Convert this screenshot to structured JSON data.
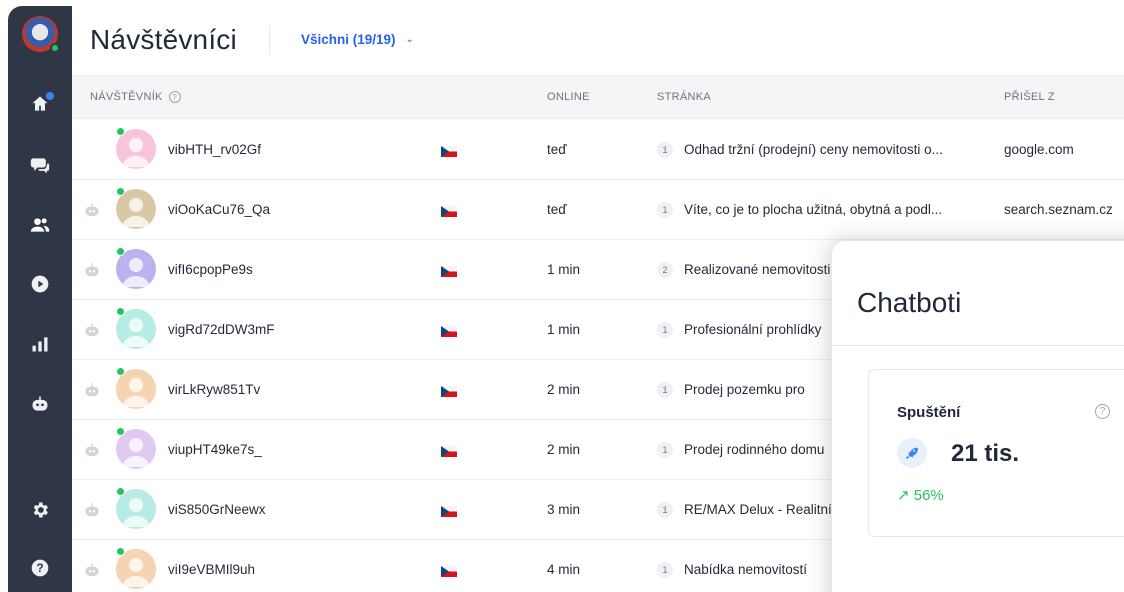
{
  "header": {
    "title": "Návštěvníci",
    "filter_label": "Všichni (19/19)"
  },
  "sidebar": {
    "items": [
      {
        "name": "home-icon"
      },
      {
        "name": "chat-icon"
      },
      {
        "name": "visitors-icon"
      },
      {
        "name": "play-icon"
      },
      {
        "name": "stats-icon"
      },
      {
        "name": "bot-icon"
      },
      {
        "name": "gear-icon"
      },
      {
        "name": "help-icon"
      }
    ]
  },
  "table": {
    "columns": {
      "visitor": "NÁVŠTĚVNÍK",
      "online": "ONLINE",
      "page": "STRÁNKA",
      "from": "PŘIŠEL Z"
    },
    "rows": [
      {
        "name": "vibHTH_rv02Gf",
        "online": "teď",
        "pages": "1",
        "page": "Odhad tržní (prodejní) ceny nemovitosti o...",
        "from": "google.com",
        "bot": false,
        "avatar_color": "#f7c6dd"
      },
      {
        "name": "viOoKaCu76_Qa",
        "online": "teď",
        "pages": "1",
        "page": "Víte, co je to plocha užitná, obytná a podl...",
        "from": "search.seznam.cz",
        "bot": true,
        "avatar_color": "#d9c8a6"
      },
      {
        "name": "vifI6cpopPe9s",
        "online": "1 min",
        "pages": "2",
        "page": "Realizované nemovitosti",
        "from": "",
        "bot": true,
        "avatar_color": "#b9b3ef"
      },
      {
        "name": "vigRd72dDW3mF",
        "online": "1 min",
        "pages": "1",
        "page": "Profesionální prohlídky",
        "from": "",
        "bot": true,
        "avatar_color": "#b7ece4"
      },
      {
        "name": "virLkRyw851Tv",
        "online": "2 min",
        "pages": "1",
        "page": "Prodej pozemku pro",
        "from": "",
        "bot": true,
        "avatar_color": "#f6d3b3"
      },
      {
        "name": "viupHT49ke7s_",
        "online": "2 min",
        "pages": "1",
        "page": "Prodej rodinného domu",
        "from": "",
        "bot": true,
        "avatar_color": "#e2c9f2"
      },
      {
        "name": "viS850GrNeewx",
        "online": "3 min",
        "pages": "1",
        "page": "RE/MAX Delux - Realitní",
        "from": "",
        "bot": true,
        "avatar_color": "#b7ece4"
      },
      {
        "name": "viI9eVBMIl9uh",
        "online": "4 min",
        "pages": "1",
        "page": "Nabídka nemovitostí",
        "from": "",
        "bot": true,
        "avatar_color": "#f6d3b3"
      }
    ]
  },
  "chatbot_panel": {
    "title": "Chatboti",
    "stat_label": "Spuštění",
    "stat_value": "21 tis.",
    "stat_trend": "↗ 56%"
  }
}
